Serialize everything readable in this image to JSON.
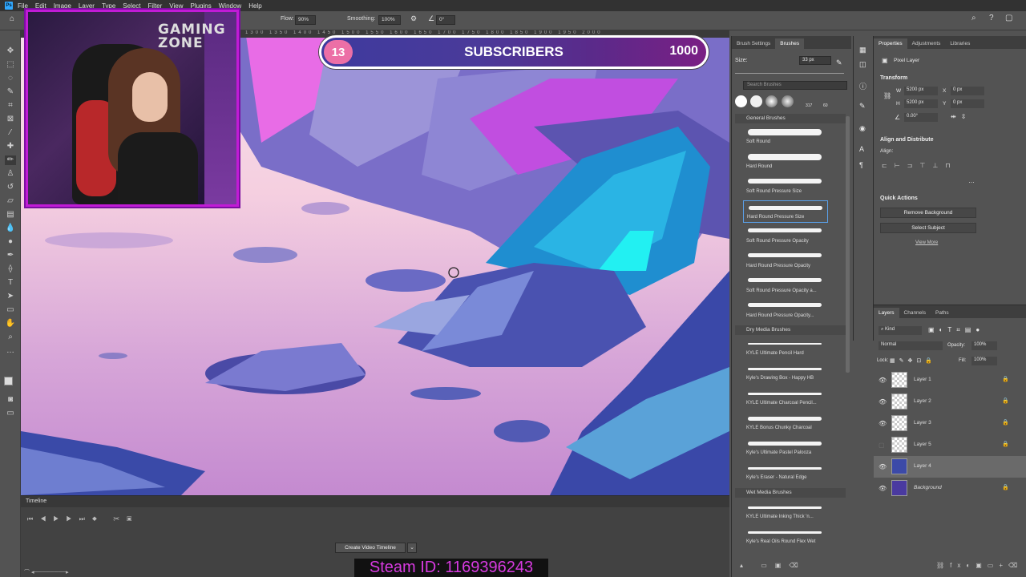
{
  "menu": [
    "File",
    "Edit",
    "Image",
    "Layer",
    "Type",
    "Select",
    "Filter",
    "View",
    "Plugins",
    "Window",
    "Help"
  ],
  "options": {
    "flow_label": "Flow:",
    "flow_value": "90%",
    "smoothing_label": "Smoothing:",
    "smoothing_value": "100%",
    "angle_value": "0°"
  },
  "ruler_text": "1300 1350 1400 1450 1500 1550 1600 1650 1700 1750 1800 1850 1900 1950 2000",
  "webcam": {
    "sign": "GAMING ZONE"
  },
  "subscribers": {
    "count": "13",
    "label": "SUBSCRIBERS",
    "goal": "1000"
  },
  "timeline": {
    "title": "Timeline",
    "create_button": "Create Video Timeline"
  },
  "steam_banner": "Steam ID: 1169396243",
  "brushes": {
    "tabs": [
      "Brush Settings",
      "Brushes"
    ],
    "size_label": "Size:",
    "size_value": "33 px",
    "search_placeholder": "Search Brushes",
    "tip_counts": [
      "317",
      "60"
    ],
    "groups": [
      {
        "name": "General Brushes",
        "items": [
          "Soft Round",
          "Hard Round",
          "Soft Round Pressure Size",
          "Hard Round Pressure Size",
          "Soft Round Pressure Opacity",
          "Hard Round Pressure Opacity",
          "Soft Round Pressure Opacity a...",
          "Hard Round Pressure Opacity..."
        ]
      },
      {
        "name": "Dry Media Brushes",
        "items": [
          "KYLE Ultimate Pencil Hard",
          "Kyle's Drawing Box - Happy HB",
          "KYLE Ultimate Charcoal Pencil...",
          "KYLE Bonus Chunky Charcoal",
          "Kyle's Ultimate Pastel Palooza",
          "Kyle's Eraser - Natural Edge"
        ]
      },
      {
        "name": "Wet Media Brushes",
        "items": [
          "KYLE Ultimate Inking Thick 'n...",
          "Kyle's Real Oils Round Flex Wet"
        ]
      }
    ]
  },
  "properties": {
    "tabs": [
      "Properties",
      "Adjustments",
      "Libraries"
    ],
    "layer_type": "Pixel Layer",
    "transform_title": "Transform",
    "w_label": "W",
    "w_value": "5200 px",
    "h_label": "H",
    "h_value": "5200 px",
    "x_label": "X",
    "x_value": "0 px",
    "y_label": "Y",
    "y_value": "0 px",
    "angle": "0.00°",
    "align_title": "Align and Distribute",
    "align_label": "Align:",
    "quick_title": "Quick Actions",
    "remove_bg": "Remove Background",
    "select_subject": "Select Subject",
    "view_more": "View More"
  },
  "layers": {
    "tabs": [
      "Layers",
      "Channels",
      "Paths"
    ],
    "kind": "Kind",
    "blend": "Normal",
    "opacity_label": "Opacity:",
    "opacity_value": "100%",
    "lock_label": "Lock:",
    "fill_label": "Fill:",
    "fill_value": "100%",
    "items": [
      "Layer 1",
      "Layer 2",
      "Layer 3",
      "Layer 5",
      "Layer 4",
      "Background"
    ]
  }
}
